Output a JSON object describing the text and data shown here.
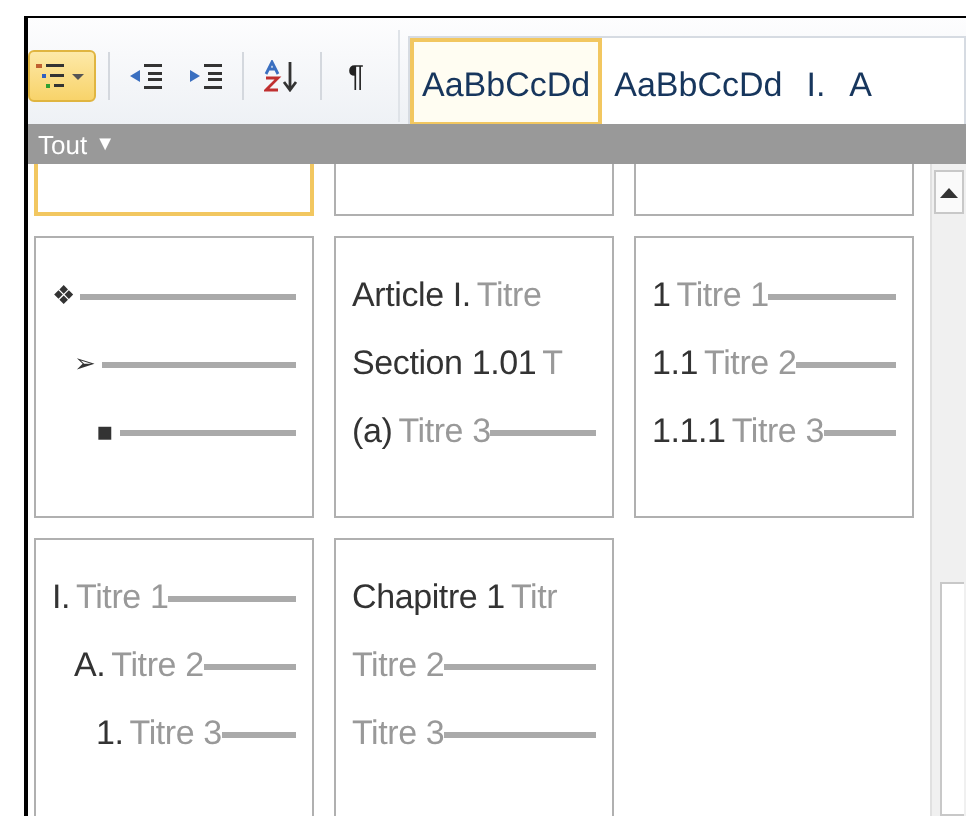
{
  "ribbon": {
    "tools": [
      {
        "kind": "multilevel",
        "selected": true
      },
      {
        "kind": "separator"
      },
      {
        "kind": "outdent",
        "selected": false
      },
      {
        "kind": "indent",
        "selected": false
      },
      {
        "kind": "separator"
      },
      {
        "kind": "sort",
        "selected": false
      },
      {
        "kind": "separator"
      },
      {
        "kind": "char",
        "label": "¶",
        "selected": false
      }
    ],
    "styles": [
      {
        "sample": "AaBbCcDd",
        "selected": true
      },
      {
        "sample": "AaBbCcDd",
        "selected": false
      },
      {
        "sample": "I.",
        "selected": false
      },
      {
        "sample": "A",
        "selected": false
      }
    ]
  },
  "filter_bar": {
    "label": "Tout",
    "caret": "▼"
  },
  "gallery": {
    "rows": [
      {
        "cards": [
          {
            "partial": true,
            "selected": true
          },
          {
            "partial": true,
            "selected": false
          },
          {
            "partial": true,
            "selected": false
          }
        ]
      },
      {
        "cards": [
          {
            "partial": false,
            "selected": false,
            "levels": [
              {
                "marker": "❖",
                "line": true,
                "children": [
                  {
                    "marker": "➢",
                    "line": true,
                    "children": [
                      {
                        "marker": "▪",
                        "line": true
                      }
                    ]
                  }
                ]
              }
            ]
          },
          {
            "partial": false,
            "selected": false,
            "levels": [
              {
                "marker": "Article I.",
                "text": "Titre"
              },
              {
                "marker": "Section 1.01",
                "text": "T"
              },
              {
                "marker": "(a)",
                "text": "Titre 3",
                "line": true
              }
            ]
          },
          {
            "partial": false,
            "selected": false,
            "levels": [
              {
                "marker": "1",
                "text": "Titre 1",
                "line": true
              },
              {
                "marker": "1.1",
                "text": "Titre 2",
                "line": true
              },
              {
                "marker": "1.1.1",
                "text": "Titre 3",
                "line": true
              }
            ]
          }
        ]
      },
      {
        "cards": [
          {
            "partial": false,
            "selected": false,
            "levels": [
              {
                "marker": "I.",
                "text": "Titre 1",
                "line": true,
                "children": [
                  {
                    "marker": "A.",
                    "text": "Titre 2",
                    "line": true,
                    "children": [
                      {
                        "marker": "1.",
                        "text": "Titre 3",
                        "line": true
                      }
                    ]
                  }
                ]
              }
            ]
          },
          {
            "partial": false,
            "selected": false,
            "levels": [
              {
                "marker": "Chapitre 1",
                "text": "Titr"
              },
              {
                "text": "Titre 2",
                "line": true
              },
              {
                "text": "Titre 3",
                "line": true
              }
            ]
          }
        ]
      }
    ]
  }
}
